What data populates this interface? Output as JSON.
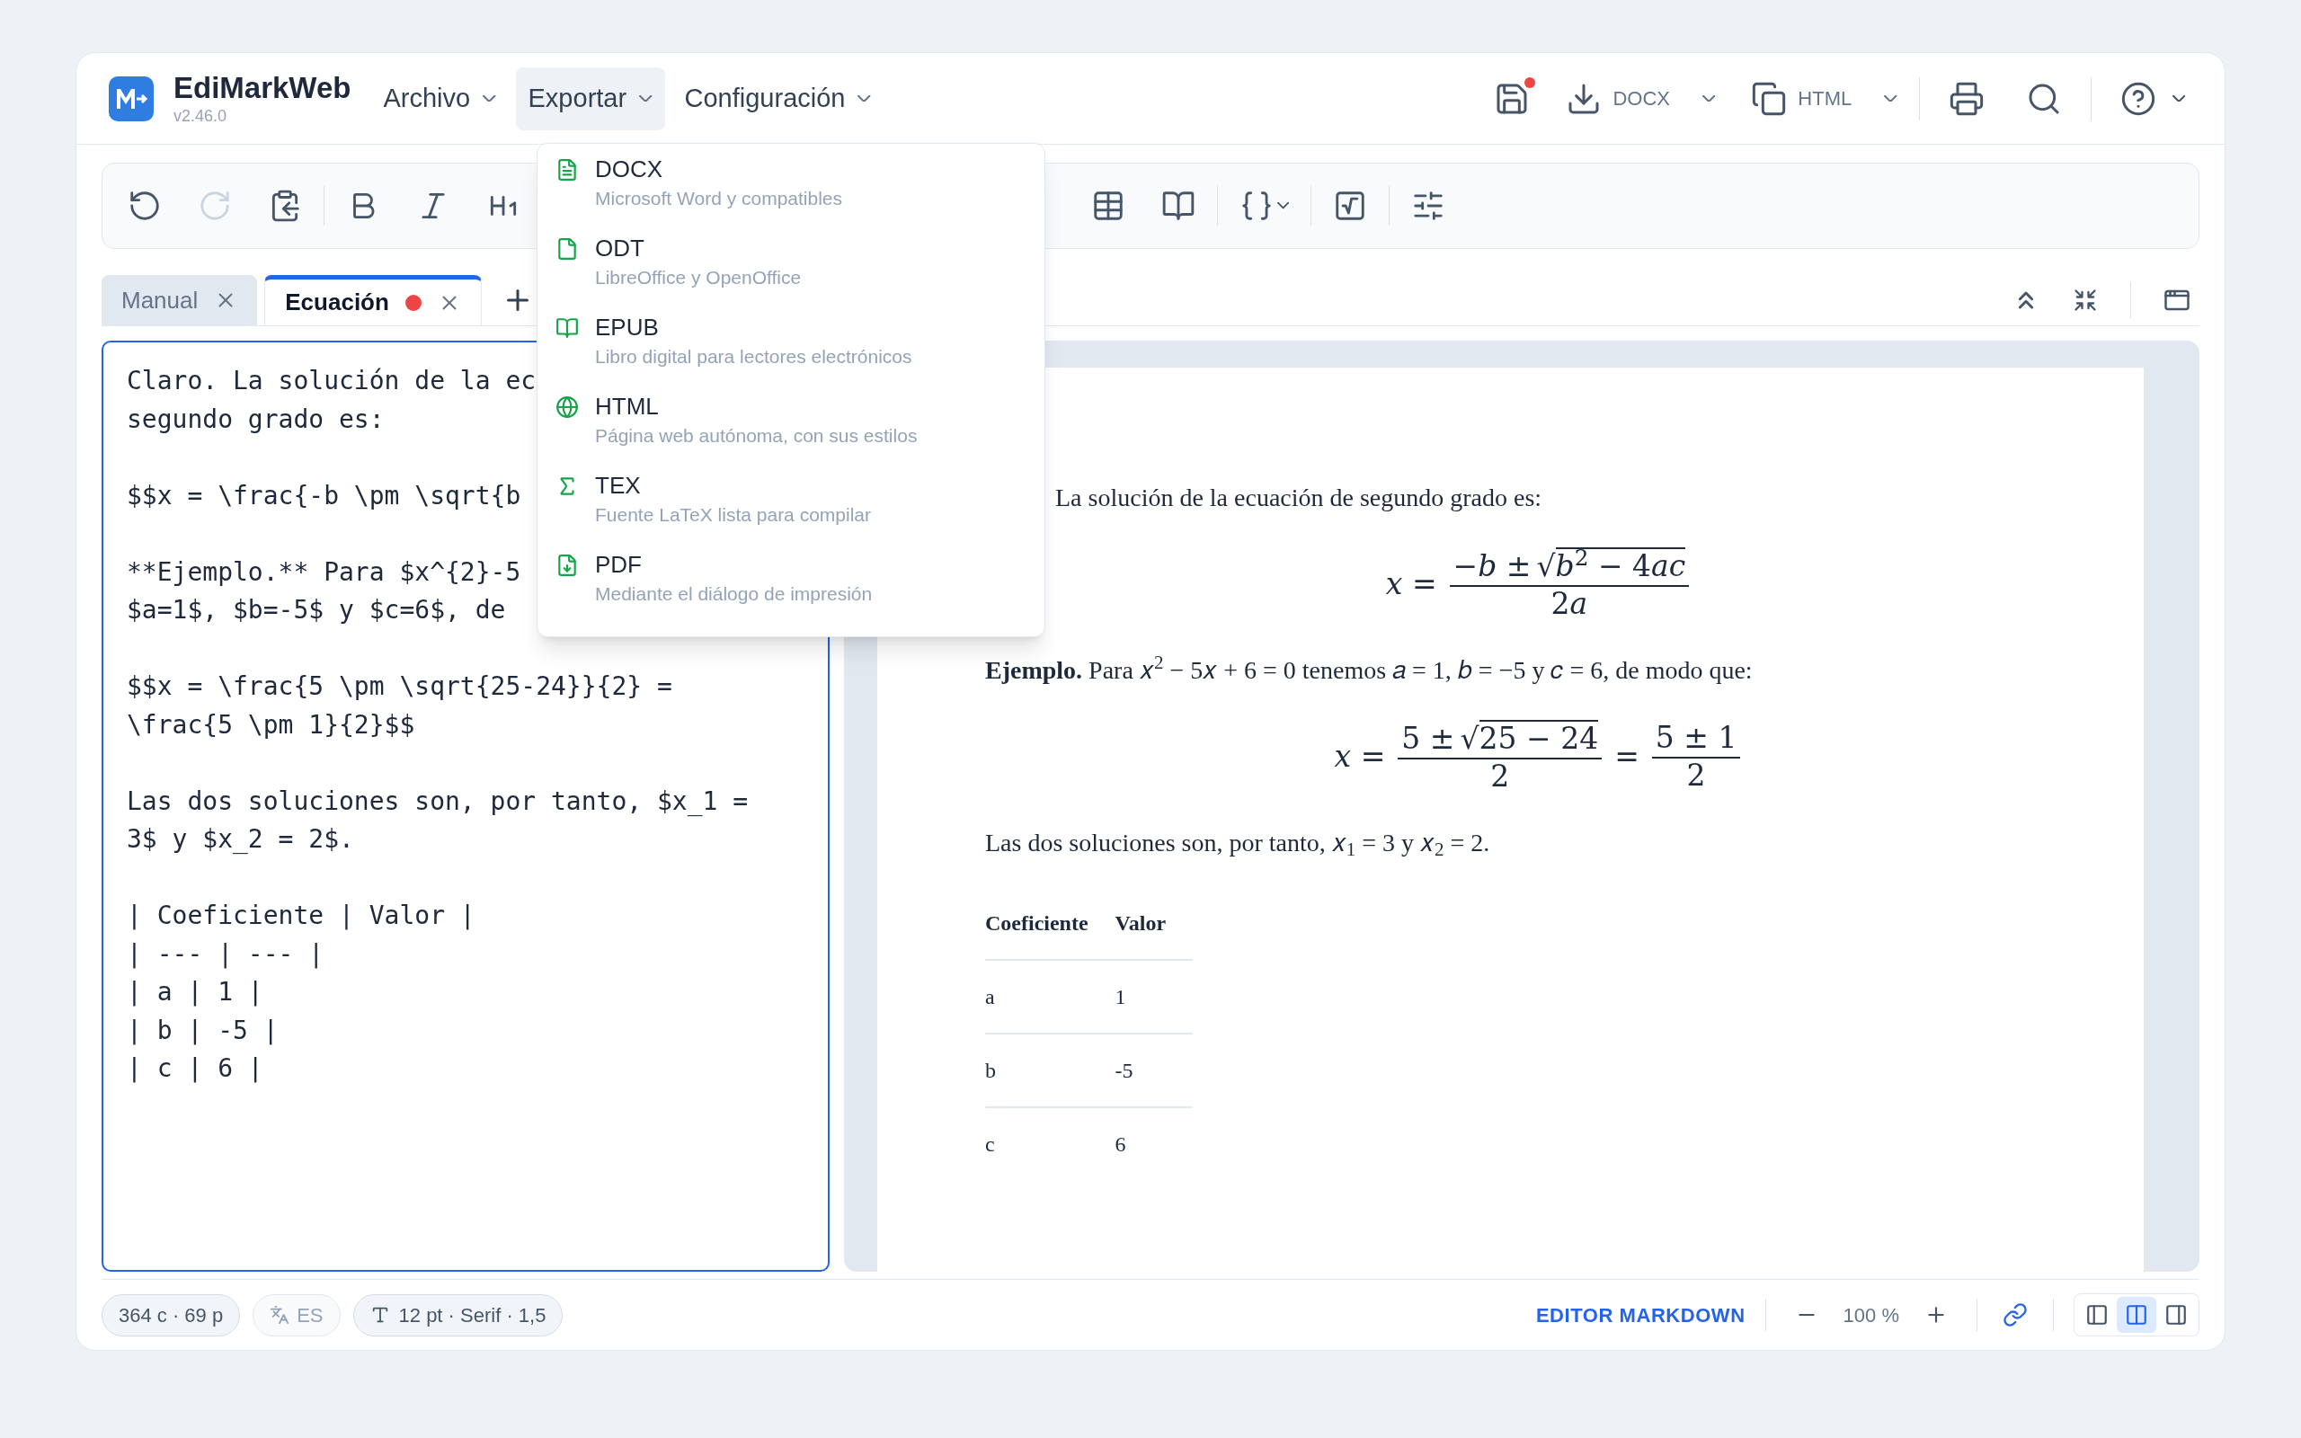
{
  "app": {
    "name": "EdiMarkWeb",
    "version": "v2.46.0"
  },
  "menus": [
    {
      "label": "Archivo",
      "selected": false
    },
    {
      "label": "Exportar",
      "selected": true
    },
    {
      "label": "Configuración",
      "selected": false
    }
  ],
  "actions": {
    "save": {
      "unsaved": true
    },
    "export": {
      "label": "DOCX"
    },
    "copy": {
      "label": "HTML"
    }
  },
  "toolbar": {
    "left_groups": [
      [
        {
          "kind": "undo",
          "disabled": false
        },
        {
          "kind": "redo",
          "disabled": true
        },
        {
          "kind": "paste",
          "disabled": false
        }
      ],
      [
        {
          "kind": "bold",
          "disabled": false
        },
        {
          "kind": "italic",
          "disabled": false
        },
        {
          "kind": "heading",
          "disabled": false
        }
      ]
    ],
    "right_groups": [
      [
        {
          "kind": "table",
          "disabled": false
        },
        {
          "kind": "book",
          "disabled": false
        }
      ],
      [
        {
          "kind": "code",
          "disabled": false
        }
      ],
      [
        {
          "kind": "formula",
          "disabled": false
        }
      ],
      [
        {
          "kind": "settings",
          "disabled": false
        }
      ]
    ]
  },
  "tabs": [
    {
      "label": "Manual",
      "selected": false,
      "unsaved": false
    },
    {
      "label": "Ecuación",
      "selected": true,
      "unsaved": true
    }
  ],
  "export_menu": [
    {
      "kind": "document",
      "label": "DOCX",
      "description": "Microsoft Word y compatibles"
    },
    {
      "kind": "file",
      "label": "ODT",
      "description": "LibreOffice y OpenOffice"
    },
    {
      "kind": "book",
      "label": "EPUB",
      "description": "Libro digital para lectores electrónicos"
    },
    {
      "kind": "web",
      "label": "HTML",
      "description": "Página web autónoma, con sus estilos"
    },
    {
      "kind": "formula",
      "label": "TEX",
      "description": "Fuente LaTeX lista para compilar"
    },
    {
      "kind": "download",
      "label": "PDF",
      "description": "Mediante el diálogo de impresión"
    }
  ],
  "editor": {
    "paragraphs": [
      [
        "Claro. La solución de la ec",
        "segundo grado es:"
      ],
      [
        "$$x = \\frac{-b \\pm \\sqrt{b"
      ],
      [
        "**Ejemplo.** Para $x^{2}-5",
        "$a=1$, $b=-5$ y $c=6$, de"
      ],
      [
        "$$x = \\frac{5 \\pm \\sqrt{25-24}}{2} =",
        "\\frac{5 \\pm 1}{2}$$"
      ],
      [
        "Las dos soluciones son, por tanto, $x_1 =",
        "3$ y $x_2 = 2$."
      ],
      [
        "| Coeficiente | Valor |",
        "| --- | --- |",
        "| a | 1 |",
        "| b | -5 |",
        "| c | 6 |"
      ]
    ]
  },
  "preview": {
    "blocks": [
      {
        "kind": "text",
        "cut": true,
        "text": "La solución de la ecuación de segundo grado es:"
      },
      {
        "kind": "formula",
        "terms": [
          {
            "kind": "operator",
            "text": "𝑥 ="
          },
          {
            "kind": "fraction",
            "num": "−𝑏 ±",
            "radical": "√",
            "radicand": "𝑏$^{2}$ − 4𝑎𝑐",
            "den": "2𝑎"
          }
        ]
      },
      {
        "kind": "text",
        "text": "**Ejemplo.** Para 𝑥$^{2}$ − 5𝑥 + 6 = 0 tenemos 𝑎 = 1, 𝑏 = −5 y 𝑐 = 6, de modo que:"
      },
      {
        "kind": "formula",
        "terms": [
          {
            "kind": "operator",
            "text": "𝑥 ="
          },
          {
            "kind": "fraction",
            "num": "5 ±",
            "radical": "√",
            "radicand": "25 − 24",
            "den": "2"
          },
          {
            "kind": "operator",
            "text": "="
          },
          {
            "kind": "fraction",
            "num": "5 ± 1",
            "den": "2"
          }
        ]
      },
      {
        "kind": "text",
        "text": "Las dos soluciones son, por tanto, 𝑥$_{1}$ = 3 y 𝑥$_{2}$ = 2."
      },
      {
        "kind": "table",
        "columns": [
          "Coeficiente",
          "Valor"
        ],
        "rows": [
          [
            "a",
            "1"
          ],
          [
            "b",
            "-5"
          ],
          [
            "c",
            "6"
          ]
        ]
      }
    ]
  },
  "status": {
    "counts": "364 c · 69 p",
    "language": {
      "label": "ES",
      "disabled": true
    },
    "font": "12 pt · Serif · 1,5",
    "mode": "EDITOR MARKDOWN",
    "zoom": "100 %",
    "view_modes": [
      {
        "kind": "editor",
        "selected": false
      },
      {
        "kind": "split",
        "selected": true
      },
      {
        "kind": "preview",
        "selected": false
      }
    ]
  }
}
